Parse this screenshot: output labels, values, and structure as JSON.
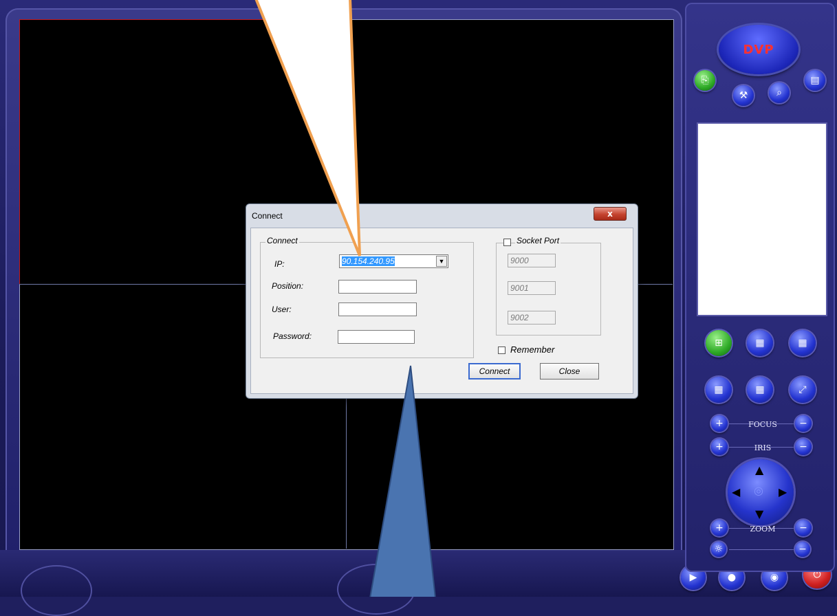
{
  "app": {
    "logo_text": "DVP",
    "controls": {
      "focus_label": "FOCUS",
      "iris_label": "IRIS",
      "zoom_label": "ZOOM"
    }
  },
  "dialog": {
    "title": "Connect",
    "close_glyph": "x",
    "connect_group": {
      "legend": "Connect",
      "ip_label": "IP:",
      "ip_value": "90.154.240.95",
      "position_label": "Position:",
      "position_value": "",
      "user_label": "User:",
      "user_value": "",
      "password_label": "Password:",
      "password_value": ""
    },
    "socket_group": {
      "legend": "Socket Port",
      "checked": false,
      "ports": [
        "9000",
        "9001",
        "9002"
      ]
    },
    "remember_label": "Remember",
    "remember_checked": false,
    "connect_button": "Connect",
    "close_button": "Close"
  },
  "colors": {
    "callout_top": "#f0a050",
    "callout_bottom": "#4a74b0",
    "active_pane": "#c21a1a"
  }
}
